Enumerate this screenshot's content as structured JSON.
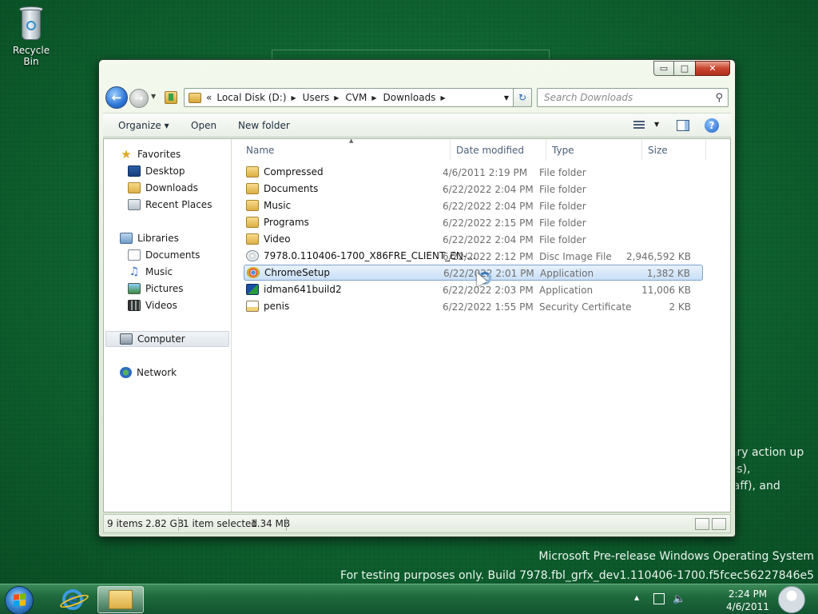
{
  "desktop": {
    "recycle_bin_label": "Recycle Bin",
    "background_text": [
      "nary action up",
      "ees),",
      "staff), and"
    ],
    "watermark": [
      "Microsoft Pre-release Windows Operating System",
      "For testing purposes only. Build 7978.fbl_grfx_dev1.110406-1700.f5fcec56227846e5"
    ]
  },
  "window": {
    "controls": {
      "minimize": "▭",
      "maximize": "□",
      "close": "✕"
    },
    "nav": {
      "back_icon": "back-arrow-icon",
      "forward_icon": "forward-arrow-icon",
      "address": {
        "overflow": "«",
        "segments": [
          "Local Disk (D:)",
          "Users",
          "CVM",
          "Downloads"
        ]
      },
      "search_placeholder": "Search Downloads"
    },
    "toolbar": {
      "organize": "Organize ▾",
      "open": "Open",
      "new_folder": "New folder"
    },
    "navpane": {
      "favorites": "Favorites",
      "favorites_items": [
        "Desktop",
        "Downloads",
        "Recent Places"
      ],
      "libraries": "Libraries",
      "libraries_items": [
        "Documents",
        "Music",
        "Pictures",
        "Videos"
      ],
      "computer": "Computer",
      "network": "Network"
    },
    "columns": {
      "name": "Name",
      "date": "Date modified",
      "type": "Type",
      "size": "Size"
    },
    "files": [
      {
        "name": "Compressed",
        "date": "4/6/2011 2:19 PM",
        "type": "File folder",
        "size": "",
        "icon": "folder-icon"
      },
      {
        "name": "Documents",
        "date": "6/22/2022 2:04 PM",
        "type": "File folder",
        "size": "",
        "icon": "folder-icon"
      },
      {
        "name": "Music",
        "date": "6/22/2022 2:04 PM",
        "type": "File folder",
        "size": "",
        "icon": "folder-icon"
      },
      {
        "name": "Programs",
        "date": "6/22/2022 2:15 PM",
        "type": "File folder",
        "size": "",
        "icon": "folder-icon"
      },
      {
        "name": "Video",
        "date": "6/22/2022 2:04 PM",
        "type": "File folder",
        "size": "",
        "icon": "folder-icon"
      },
      {
        "name": "7978.0.110406-1700_X86FRE_CLIENT_EN-...",
        "date": "6/22/2022 2:12 PM",
        "type": "Disc Image File",
        "size": "2,946,592 KB",
        "icon": "disc-image-icon"
      },
      {
        "name": "ChromeSetup",
        "date": "6/22/2022 2:01 PM",
        "type": "Application",
        "size": "1,382 KB",
        "icon": "chrome-icon",
        "selected": true
      },
      {
        "name": "idman641build2",
        "date": "6/22/2022 2:03 PM",
        "type": "Application",
        "size": "11,006 KB",
        "icon": "idm-icon"
      },
      {
        "name": "penis",
        "date": "6/22/2022 1:55 PM",
        "type": "Security Certificate",
        "size": "2 KB",
        "icon": "certificate-icon"
      }
    ],
    "status": {
      "count": "9 items",
      "total_size": "2.82 GB",
      "selection": "1 item selected",
      "selection_size": "1.34 MB"
    }
  },
  "taskbar": {
    "clock_time": "2:24 PM",
    "clock_date": "4/6/2011"
  }
}
